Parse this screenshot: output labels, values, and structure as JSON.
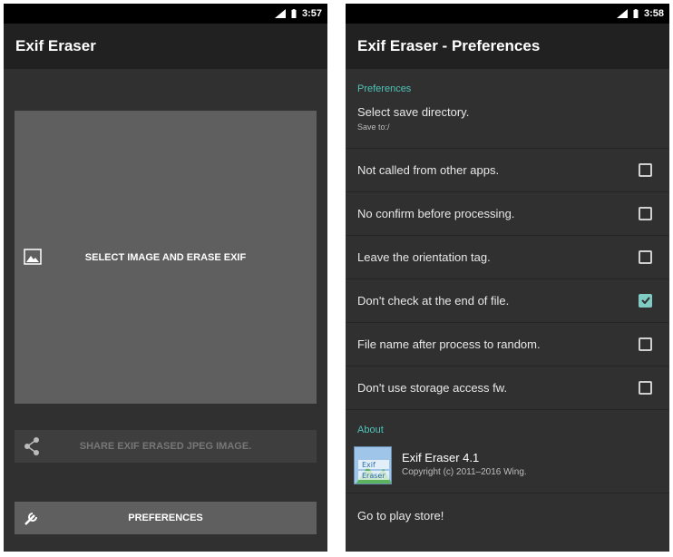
{
  "left": {
    "status_time": "3:57",
    "app_title": "Exif Eraser",
    "select_button_label": "SELECT IMAGE AND ERASE EXIF",
    "share_button_label": "SHARE EXIF ERASED JPEG IMAGE.",
    "preferences_button_label": "PREFERENCES"
  },
  "right": {
    "status_time": "3:58",
    "app_title": "Exif Eraser - Preferences",
    "preferences_header": "Preferences",
    "save_directory": {
      "title": "Select save directory.",
      "summary": "Save to:/"
    },
    "options": [
      {
        "label": "Not called from other apps.",
        "checked": false
      },
      {
        "label": "No confirm before processing.",
        "checked": false
      },
      {
        "label": "Leave the orientation tag.",
        "checked": false
      },
      {
        "label": "Don't check at the end of file.",
        "checked": true
      },
      {
        "label": "File name after process to random.",
        "checked": false
      },
      {
        "label": "Don't use storage access fw.",
        "checked": false
      }
    ],
    "about_header": "About",
    "about": {
      "app_name": "Exif Eraser  4.1",
      "copyright": "Copyright (c) 2011–2016 Wing.",
      "icon_text": [
        "Exif",
        "Eraser"
      ]
    },
    "play_store_label": "Go to play store!"
  },
  "colors": {
    "accent": "#4fc3b8",
    "checked": "#80cbc4",
    "background": "#303030",
    "appbar": "#212121"
  }
}
